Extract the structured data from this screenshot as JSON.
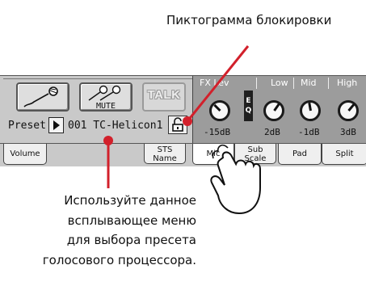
{
  "callouts": {
    "lock_icon": "Пиктограмма блокировки",
    "preset_menu_lines": [
      "Используйте данное",
      "всплывающее меню",
      "для выбора пресета",
      "голосового процессора."
    ]
  },
  "mic_buttons": {
    "mute_label": "MUTE",
    "talk_label": "TALK"
  },
  "preset": {
    "label": "Preset:",
    "value": "001 TC-Helicon1"
  },
  "fx": {
    "headers": [
      "FX Lev",
      "Low",
      "Mid",
      "High"
    ],
    "values": [
      "-15dB",
      "2dB",
      "-1dB",
      "3dB"
    ],
    "eq_letters": [
      "E",
      "Q"
    ]
  },
  "tabs": [
    {
      "lines": [
        "Volume"
      ]
    },
    {
      "lines": [
        "STS",
        "Name"
      ]
    },
    {
      "lines": [
        "Mic"
      ]
    },
    {
      "lines": [
        "Sub",
        "Scale"
      ]
    },
    {
      "lines": [
        "Pad"
      ]
    },
    {
      "lines": [
        "Split"
      ]
    }
  ],
  "colors": {
    "accent_red": "#d2202b",
    "panel_bg": "#c9c9c9",
    "fx_bg": "#9c9c9c"
  },
  "icons": [
    "microphone-icon",
    "dual-microphone-icon",
    "padlock-icon",
    "pointing-hand-icon"
  ]
}
